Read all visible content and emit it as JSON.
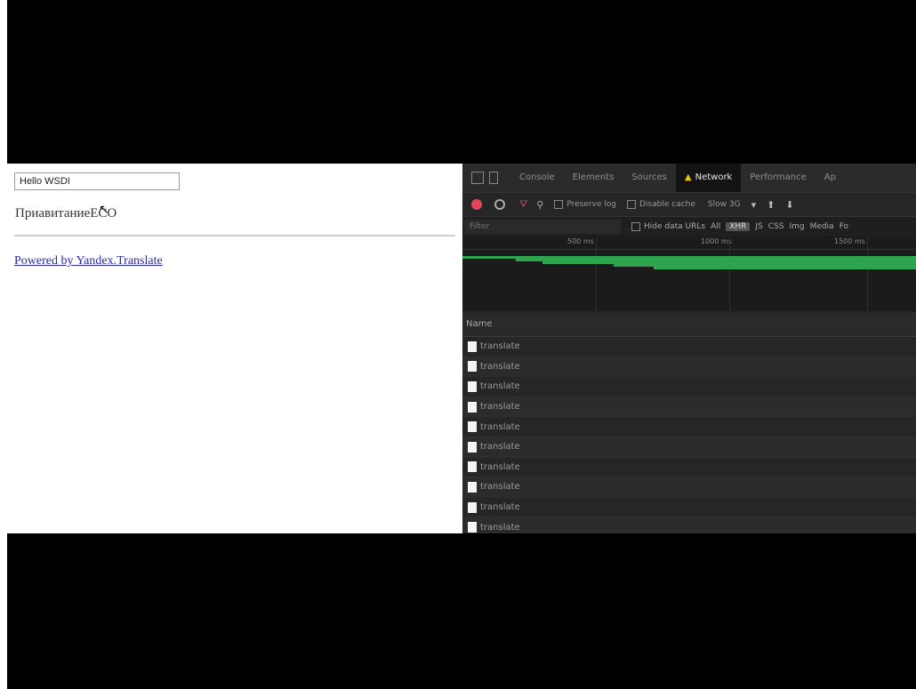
{
  "page": {
    "input_value": "Hello WSDI",
    "translated_text": "ПриавитаниеЕСO",
    "link_text": "Powered by Yandex.Translate"
  },
  "devtools": {
    "tabs": [
      "Console",
      "Elements",
      "Sources",
      "Network",
      "Performance",
      "Ap"
    ],
    "active_tab": "Network",
    "toolbar": {
      "preserve_log": "Preserve log",
      "disable_cache": "Disable cache",
      "throttle": "Slow 3G"
    },
    "filter": {
      "placeholder": "Filter",
      "hide_data_urls": "Hide data URLs",
      "types": [
        "All",
        "XHR",
        "JS",
        "CSS",
        "Img",
        "Media",
        "Fo"
      ]
    },
    "timeline_ticks": [
      "500 ms",
      "1000 ms",
      "1500 ms"
    ],
    "list_header": "Name",
    "requests": [
      "translate",
      "translate",
      "translate",
      "translate",
      "translate",
      "translate",
      "translate",
      "translate",
      "translate",
      "translate"
    ]
  },
  "colors": {
    "record": "#e0475b",
    "waterfall": "#2ea44f",
    "warning": "#f2c200",
    "link": "#2a2aa8"
  }
}
